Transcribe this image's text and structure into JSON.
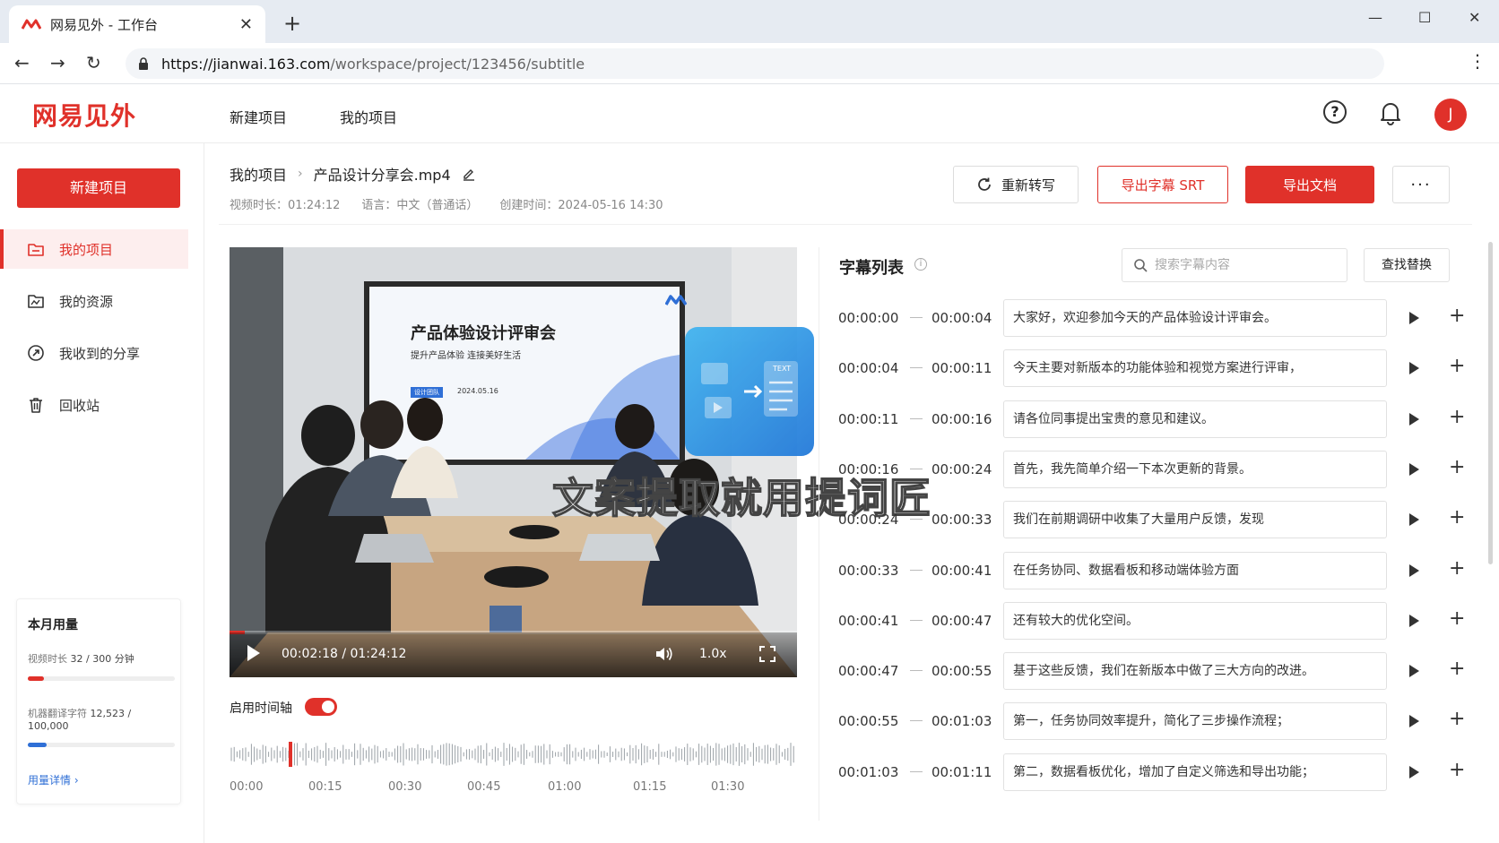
{
  "browser": {
    "tab_title": "网易见外 - 工作台",
    "url_host": "https://jianwai.163.com",
    "url_path": "/workspace/project/123456/subtitle"
  },
  "header": {
    "logo": "网易见外",
    "nav": [
      "新建项目",
      "我的项目"
    ],
    "avatar_letter": "J"
  },
  "sidebar": {
    "new_project": "新建项目",
    "items": [
      {
        "label": "我的项目",
        "icon": "folder-icon",
        "active": true
      },
      {
        "label": "我的资源",
        "icon": "resource-icon",
        "active": false
      },
      {
        "label": "我收到的分享",
        "icon": "share-icon",
        "active": false
      },
      {
        "label": "回收站",
        "icon": "trash-icon",
        "active": false
      }
    ],
    "usage": {
      "title": "本月用量",
      "video_label": "视频时长",
      "video_value": "32 / 300 分钟",
      "video_fraction": 0.107,
      "mt_label": "机器翻译字符",
      "mt_value": "12,523 / 100,000",
      "mt_fraction": 0.125,
      "link": "用量详情 ›"
    }
  },
  "main": {
    "breadcrumb_parent": "我的项目",
    "breadcrumb_current": "产品设计分享会.mp4",
    "meta_duration": "视频时长：01:24:12",
    "meta_language": "语言：中文（普通话）",
    "meta_created": "创建时间：2024-05-16 14:30",
    "btn_retranscribe": "重新转写",
    "btn_export_srt": "导出字幕 SRT",
    "btn_export_doc": "导出文档",
    "btn_more": "···"
  },
  "video": {
    "slide_title": "产品体验设计评审会",
    "slide_subtitle": "提升产品体验  连接美好生活",
    "slide_tag": "设计团队",
    "slide_date": "2024.05.16",
    "time": "00:02:18 / 01:24:12",
    "progress_fraction": 0.027,
    "speed": "1.0x"
  },
  "watermark": "文案提取就用提词匠",
  "badge_text": "TEXT",
  "timeline": {
    "label": "启用时间轴",
    "ticks": [
      "00:00",
      "00:15",
      "00:30",
      "00:45",
      "01:00",
      "01:15",
      "01:30"
    ]
  },
  "subtitles": {
    "title": "字幕列表",
    "search_placeholder": "搜索字幕内容",
    "replace_btn": "查找替换",
    "rows": [
      {
        "start": "00:00:00",
        "end": "00:00:04",
        "text": "大家好，欢迎参加今天的产品体验设计评审会。"
      },
      {
        "start": "00:00:04",
        "end": "00:00:11",
        "text": "今天主要对新版本的功能体验和视觉方案进行评审，"
      },
      {
        "start": "00:00:11",
        "end": "00:00:16",
        "text": "请各位同事提出宝贵的意见和建议。"
      },
      {
        "start": "00:00:16",
        "end": "00:00:24",
        "text": "首先，我先简单介绍一下本次更新的背景。"
      },
      {
        "start": "00:00:24",
        "end": "00:00:33",
        "text": "我们在前期调研中收集了大量用户反馈，发现"
      },
      {
        "start": "00:00:33",
        "end": "00:00:41",
        "text": "在任务协同、数据看板和移动端体验方面"
      },
      {
        "start": "00:00:41",
        "end": "00:00:47",
        "text": "还有较大的优化空间。"
      },
      {
        "start": "00:00:47",
        "end": "00:00:55",
        "text": "基于这些反馈，我们在新版本中做了三大方向的改进。"
      },
      {
        "start": "00:00:55",
        "end": "00:01:03",
        "text": "第一，任务协同效率提升，简化了三步操作流程；"
      },
      {
        "start": "00:01:03",
        "end": "00:01:11",
        "text": "第二，数据看板优化，增加了自定义筛选和导出功能；"
      }
    ]
  },
  "colors": {
    "brand": "#e0312a",
    "link": "#2f6fd6",
    "usage_bar_video": "#e0312a",
    "usage_bar_mt": "#2f6fd6"
  }
}
